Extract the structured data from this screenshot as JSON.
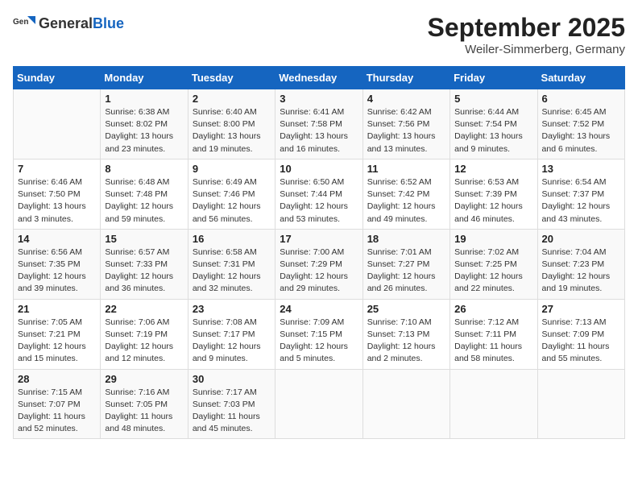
{
  "header": {
    "logo_general": "General",
    "logo_blue": "Blue",
    "month": "September 2025",
    "location": "Weiler-Simmerberg, Germany"
  },
  "weekdays": [
    "Sunday",
    "Monday",
    "Tuesday",
    "Wednesday",
    "Thursday",
    "Friday",
    "Saturday"
  ],
  "weeks": [
    [
      {
        "day": "",
        "info": ""
      },
      {
        "day": "1",
        "info": "Sunrise: 6:38 AM\nSunset: 8:02 PM\nDaylight: 13 hours\nand 23 minutes."
      },
      {
        "day": "2",
        "info": "Sunrise: 6:40 AM\nSunset: 8:00 PM\nDaylight: 13 hours\nand 19 minutes."
      },
      {
        "day": "3",
        "info": "Sunrise: 6:41 AM\nSunset: 7:58 PM\nDaylight: 13 hours\nand 16 minutes."
      },
      {
        "day": "4",
        "info": "Sunrise: 6:42 AM\nSunset: 7:56 PM\nDaylight: 13 hours\nand 13 minutes."
      },
      {
        "day": "5",
        "info": "Sunrise: 6:44 AM\nSunset: 7:54 PM\nDaylight: 13 hours\nand 9 minutes."
      },
      {
        "day": "6",
        "info": "Sunrise: 6:45 AM\nSunset: 7:52 PM\nDaylight: 13 hours\nand 6 minutes."
      }
    ],
    [
      {
        "day": "7",
        "info": "Sunrise: 6:46 AM\nSunset: 7:50 PM\nDaylight: 13 hours\nand 3 minutes."
      },
      {
        "day": "8",
        "info": "Sunrise: 6:48 AM\nSunset: 7:48 PM\nDaylight: 12 hours\nand 59 minutes."
      },
      {
        "day": "9",
        "info": "Sunrise: 6:49 AM\nSunset: 7:46 PM\nDaylight: 12 hours\nand 56 minutes."
      },
      {
        "day": "10",
        "info": "Sunrise: 6:50 AM\nSunset: 7:44 PM\nDaylight: 12 hours\nand 53 minutes."
      },
      {
        "day": "11",
        "info": "Sunrise: 6:52 AM\nSunset: 7:42 PM\nDaylight: 12 hours\nand 49 minutes."
      },
      {
        "day": "12",
        "info": "Sunrise: 6:53 AM\nSunset: 7:39 PM\nDaylight: 12 hours\nand 46 minutes."
      },
      {
        "day": "13",
        "info": "Sunrise: 6:54 AM\nSunset: 7:37 PM\nDaylight: 12 hours\nand 43 minutes."
      }
    ],
    [
      {
        "day": "14",
        "info": "Sunrise: 6:56 AM\nSunset: 7:35 PM\nDaylight: 12 hours\nand 39 minutes."
      },
      {
        "day": "15",
        "info": "Sunrise: 6:57 AM\nSunset: 7:33 PM\nDaylight: 12 hours\nand 36 minutes."
      },
      {
        "day": "16",
        "info": "Sunrise: 6:58 AM\nSunset: 7:31 PM\nDaylight: 12 hours\nand 32 minutes."
      },
      {
        "day": "17",
        "info": "Sunrise: 7:00 AM\nSunset: 7:29 PM\nDaylight: 12 hours\nand 29 minutes."
      },
      {
        "day": "18",
        "info": "Sunrise: 7:01 AM\nSunset: 7:27 PM\nDaylight: 12 hours\nand 26 minutes."
      },
      {
        "day": "19",
        "info": "Sunrise: 7:02 AM\nSunset: 7:25 PM\nDaylight: 12 hours\nand 22 minutes."
      },
      {
        "day": "20",
        "info": "Sunrise: 7:04 AM\nSunset: 7:23 PM\nDaylight: 12 hours\nand 19 minutes."
      }
    ],
    [
      {
        "day": "21",
        "info": "Sunrise: 7:05 AM\nSunset: 7:21 PM\nDaylight: 12 hours\nand 15 minutes."
      },
      {
        "day": "22",
        "info": "Sunrise: 7:06 AM\nSunset: 7:19 PM\nDaylight: 12 hours\nand 12 minutes."
      },
      {
        "day": "23",
        "info": "Sunrise: 7:08 AM\nSunset: 7:17 PM\nDaylight: 12 hours\nand 9 minutes."
      },
      {
        "day": "24",
        "info": "Sunrise: 7:09 AM\nSunset: 7:15 PM\nDaylight: 12 hours\nand 5 minutes."
      },
      {
        "day": "25",
        "info": "Sunrise: 7:10 AM\nSunset: 7:13 PM\nDaylight: 12 hours\nand 2 minutes."
      },
      {
        "day": "26",
        "info": "Sunrise: 7:12 AM\nSunset: 7:11 PM\nDaylight: 11 hours\nand 58 minutes."
      },
      {
        "day": "27",
        "info": "Sunrise: 7:13 AM\nSunset: 7:09 PM\nDaylight: 11 hours\nand 55 minutes."
      }
    ],
    [
      {
        "day": "28",
        "info": "Sunrise: 7:15 AM\nSunset: 7:07 PM\nDaylight: 11 hours\nand 52 minutes."
      },
      {
        "day": "29",
        "info": "Sunrise: 7:16 AM\nSunset: 7:05 PM\nDaylight: 11 hours\nand 48 minutes."
      },
      {
        "day": "30",
        "info": "Sunrise: 7:17 AM\nSunset: 7:03 PM\nDaylight: 11 hours\nand 45 minutes."
      },
      {
        "day": "",
        "info": ""
      },
      {
        "day": "",
        "info": ""
      },
      {
        "day": "",
        "info": ""
      },
      {
        "day": "",
        "info": ""
      }
    ]
  ]
}
